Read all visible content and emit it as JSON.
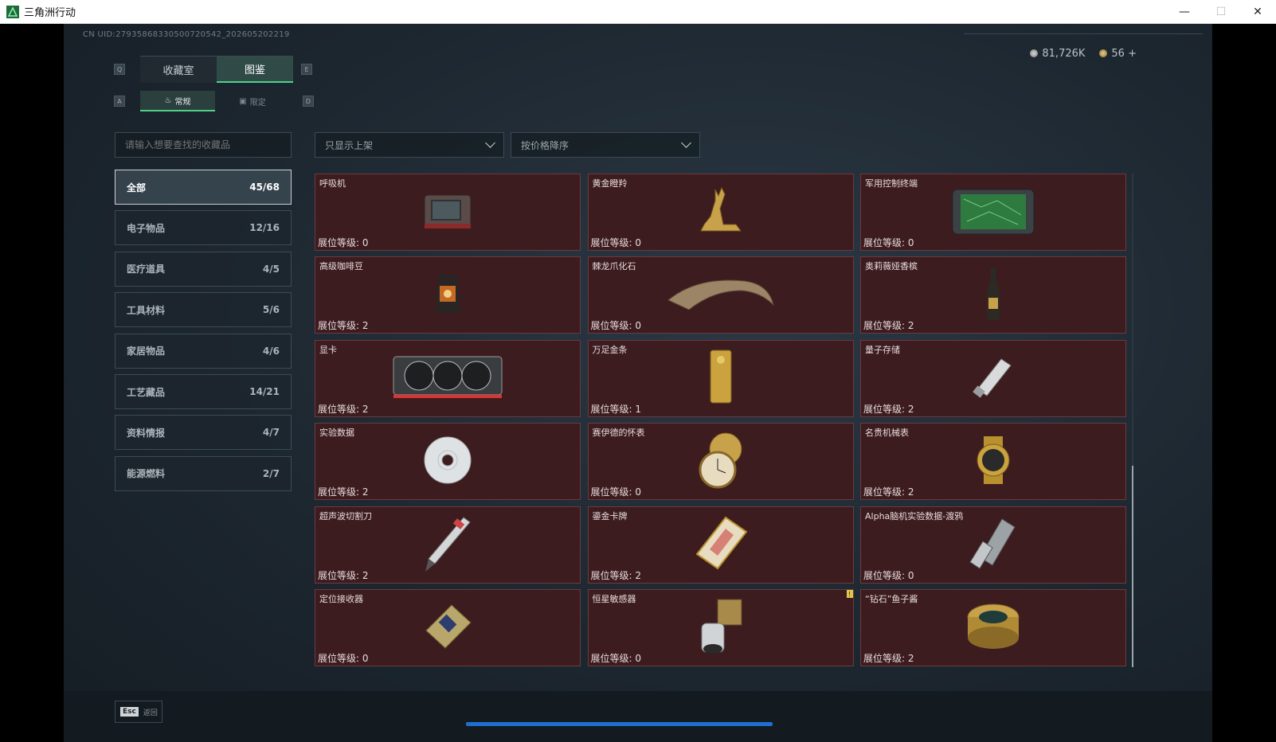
{
  "window": {
    "title": "三角洲行动",
    "minimize": "—",
    "maximize": "☐",
    "close": "✕"
  },
  "uid": "CN UID:2793586833050072054​2_202605202219",
  "currency": {
    "silver": "81,726K",
    "gold": "56",
    "plus": "+"
  },
  "keys": {
    "q": "Q",
    "e": "E",
    "a": "A",
    "d": "D"
  },
  "tabs": {
    "collection_room": "收藏室",
    "catalog": "图鉴"
  },
  "subtabs": {
    "regular": "常规",
    "limited": "限定"
  },
  "search": {
    "placeholder": "请输入想要查找的收藏品"
  },
  "filters": {
    "listing": "只显示上架",
    "sort": "按价格降序"
  },
  "categories": [
    {
      "label": "全部",
      "count": "45/68"
    },
    {
      "label": "电子物品",
      "count": "12/16"
    },
    {
      "label": "医疗道具",
      "count": "4/5"
    },
    {
      "label": "工具材料",
      "count": "5/6"
    },
    {
      "label": "家居物品",
      "count": "4/6"
    },
    {
      "label": "工艺藏品",
      "count": "14/21"
    },
    {
      "label": "资料情报",
      "count": "4/7"
    },
    {
      "label": "能源燃料",
      "count": "2/7"
    }
  ],
  "level_prefix": "展位等级:",
  "items": [
    {
      "name": "呼吸机",
      "level": "0",
      "icon": "ventilator-icon"
    },
    {
      "name": "黄金瞪羚",
      "level": "0",
      "icon": "gold-gazelle-icon"
    },
    {
      "name": "军用控制终端",
      "level": "0",
      "icon": "military-terminal-icon"
    },
    {
      "name": "高级咖啡豆",
      "level": "2",
      "icon": "coffee-bag-icon"
    },
    {
      "name": "棘龙爪化石",
      "level": "0",
      "icon": "claw-fossil-icon"
    },
    {
      "name": "奥莉薇娅香槟",
      "level": "2",
      "icon": "champagne-icon"
    },
    {
      "name": "显卡",
      "level": "2",
      "icon": "gpu-icon"
    },
    {
      "name": "万足金条",
      "level": "1",
      "icon": "gold-bar-icon"
    },
    {
      "name": "量子存储",
      "level": "2",
      "icon": "usb-icon"
    },
    {
      "name": "实验数据",
      "level": "2",
      "icon": "disc-icon"
    },
    {
      "name": "赛伊德的怀表",
      "level": "0",
      "icon": "pocket-watch-icon"
    },
    {
      "name": "名贵机械表",
      "level": "2",
      "icon": "wristwatch-icon"
    },
    {
      "name": "超声波切割刀",
      "level": "2",
      "icon": "cutter-icon"
    },
    {
      "name": "鎏金卡牌",
      "level": "2",
      "icon": "gold-card-icon"
    },
    {
      "name": "Alpha脑机实验数据-渡鸦",
      "level": "0",
      "icon": "canister-icon"
    },
    {
      "name": "定位接收器",
      "level": "0",
      "icon": "receiver-icon"
    },
    {
      "name": "恒星敏感器",
      "level": "0",
      "icon": "star-sensor-icon",
      "badge": "!"
    },
    {
      "name": "“钻石”鱼子酱",
      "level": "2",
      "icon": "caviar-icon"
    }
  ],
  "footer": {
    "esc_key": "Esc",
    "esc_label": "返回"
  }
}
